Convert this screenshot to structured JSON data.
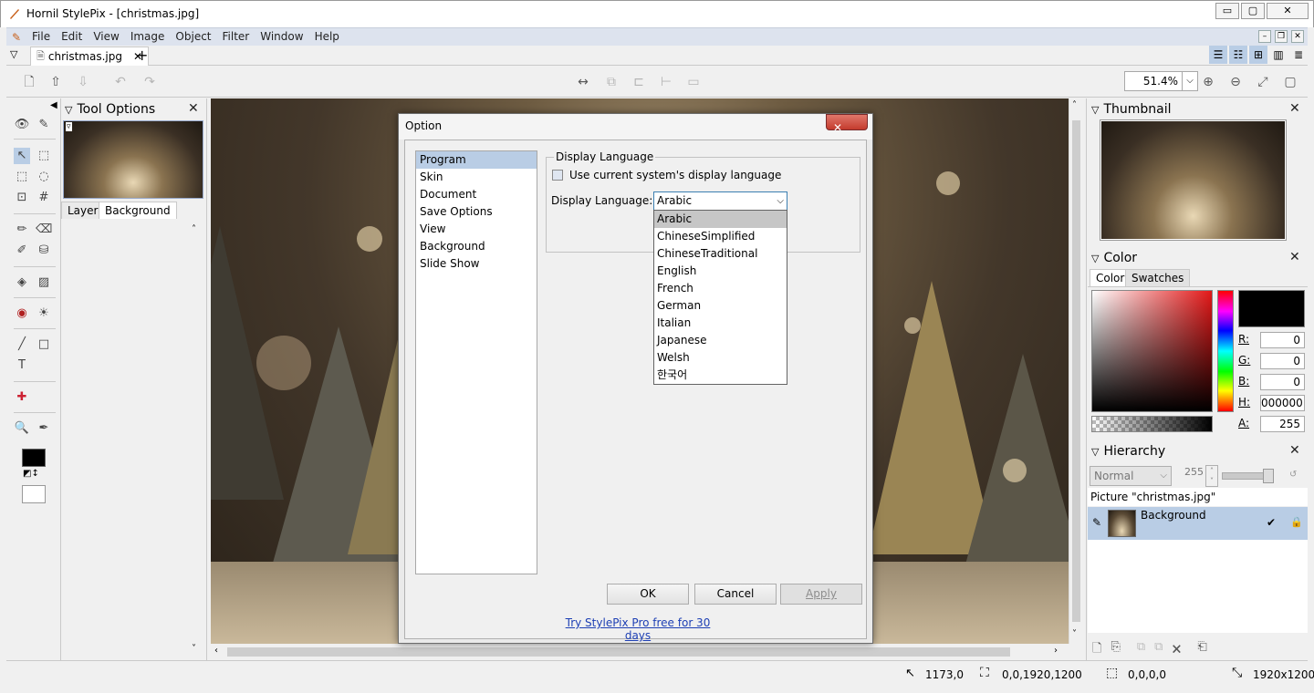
{
  "window": {
    "title": "Hornil StylePix - [christmas.jpg]",
    "min": "▭",
    "max": "▢",
    "close": "✕"
  },
  "menu": [
    "File",
    "Edit",
    "View",
    "Image",
    "Object",
    "Filter",
    "Window",
    "Help"
  ],
  "doc_tab": {
    "label": "christmas.jpg",
    "close": "✕",
    "add": "+"
  },
  "toolbar": {
    "zoom": "51.4%"
  },
  "tool_options": {
    "title": "Tool Options",
    "tabs": [
      "Layer",
      "Background"
    ]
  },
  "thumbnail": {
    "title": "Thumbnail"
  },
  "color": {
    "title": "Color",
    "tabs": [
      "Color",
      "Swatches"
    ],
    "fields": [
      {
        "label": "R:",
        "value": "0"
      },
      {
        "label": "G:",
        "value": "0"
      },
      {
        "label": "B:",
        "value": "0"
      },
      {
        "label": "H:",
        "value": "000000"
      },
      {
        "label": "A:",
        "value": "255"
      }
    ]
  },
  "hierarchy": {
    "title": "Hierarchy",
    "blend": "Normal",
    "opacity": "255",
    "picture": "Picture \"christmas.jpg\"",
    "layer": "Background"
  },
  "status": {
    "cursor": "1173,0",
    "selection": "0,0,1920,1200",
    "rect": "0,0,0,0",
    "size": "1920x1200"
  },
  "dialog": {
    "title": "Option",
    "close": "✕",
    "categories": [
      "Program",
      "Skin",
      "Document",
      "Save Options",
      "View",
      "Background",
      "Slide Show"
    ],
    "selected_category": "Program",
    "group_label": "Display Language",
    "checkbox_label": "Use current system's display language",
    "lang_label": "Display Language:",
    "lang_value": "Arabic",
    "languages": [
      "Arabic",
      "ChineseSimplified",
      "ChineseTraditional",
      "English",
      "French",
      "German",
      "Italian",
      "Japanese",
      "Welsh",
      "한국어"
    ],
    "ok": "OK",
    "cancel": "Cancel",
    "apply": "Apply",
    "promo": "Try StylePix Pro free for 30 days"
  }
}
